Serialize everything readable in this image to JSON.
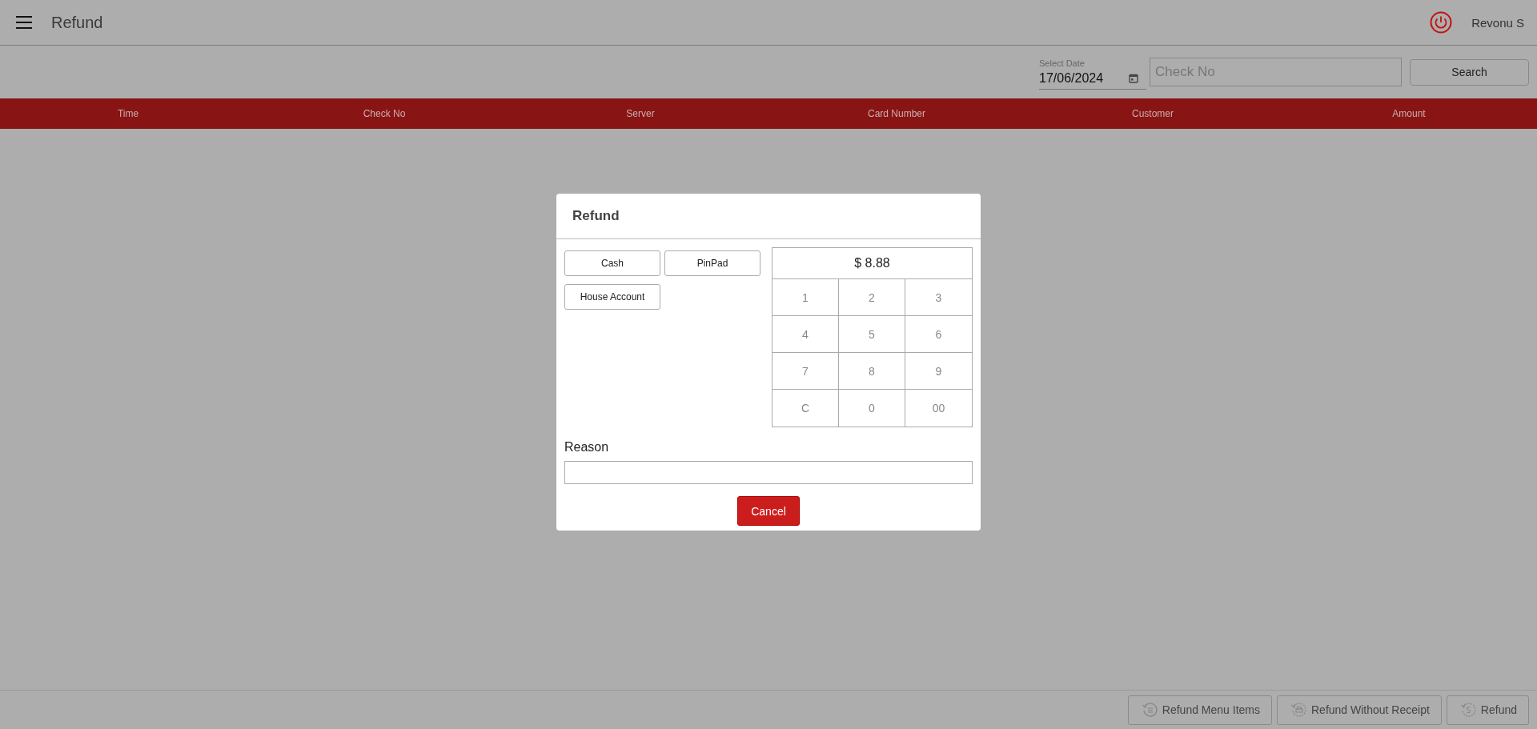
{
  "header": {
    "title": "Refund",
    "user": "Revonu S"
  },
  "filters": {
    "date_label": "Select Date",
    "date_value": "17/06/2024",
    "check_placeholder": "Check No",
    "search_button": "Search"
  },
  "table": {
    "columns": [
      "Time",
      "Check No",
      "Server",
      "Card Number",
      "Customer",
      "Amount"
    ]
  },
  "dialog": {
    "title": "Refund",
    "payment_buttons": [
      "Cash",
      "PinPad",
      "House Account"
    ],
    "amount": "$ 8.88",
    "keys": [
      "1",
      "2",
      "3",
      "4",
      "5",
      "6",
      "7",
      "8",
      "9",
      "C",
      "0",
      "00"
    ],
    "reason_label": "Reason",
    "cancel_button": "Cancel"
  },
  "footer_buttons": [
    {
      "label": "Refund Menu Items",
      "kind": "menu"
    },
    {
      "label": "Refund Without Receipt",
      "kind": "receipt"
    },
    {
      "label": "Refund",
      "kind": "money"
    }
  ]
}
